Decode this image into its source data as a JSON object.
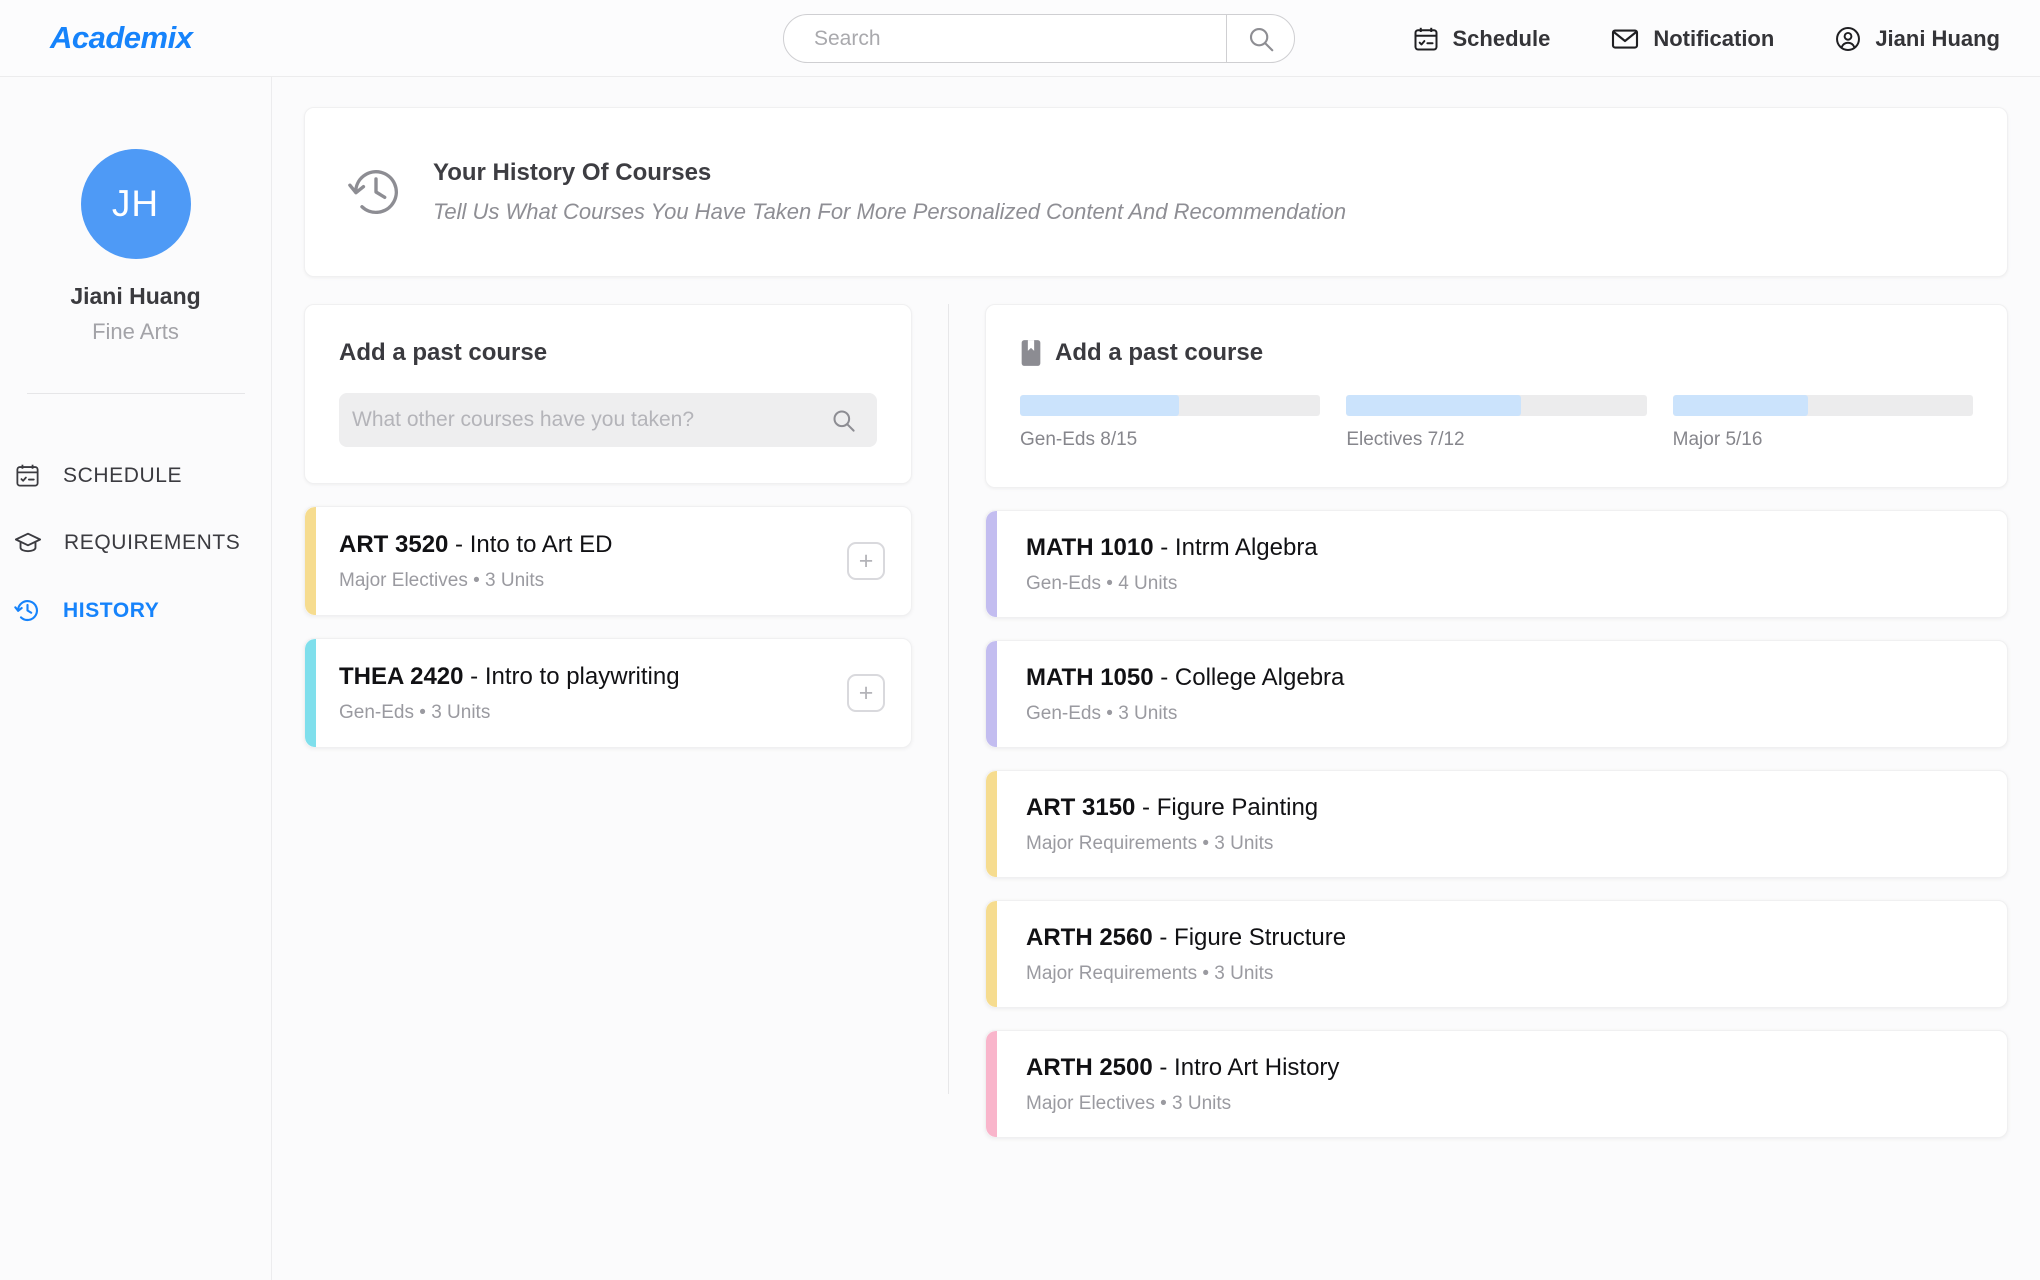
{
  "brand": {
    "name": "Academix"
  },
  "header": {
    "search": {
      "value": "",
      "placeholder": "Search"
    },
    "nav": [
      {
        "label": "Schedule",
        "icon": "calendar-check-icon"
      },
      {
        "label": "Notification",
        "icon": "envelope-icon"
      },
      {
        "label": "Jiani Huang",
        "icon": "user-circle-icon"
      }
    ]
  },
  "sidebar": {
    "avatar_initials": "JH",
    "user_name": "Jiani Huang",
    "user_major": "Fine Arts",
    "items": [
      {
        "label": "SCHEDULE",
        "icon": "calendar-check-icon",
        "active": false
      },
      {
        "label": "REQUIREMENTS",
        "icon": "graduation-cap-icon",
        "active": false
      },
      {
        "label": "HISTORY",
        "icon": "history-clock-icon",
        "active": true
      }
    ]
  },
  "banner": {
    "icon": "history-clock-icon",
    "title": "Your History Of Courses",
    "subtitle": "Tell Us What Courses You Have Taken For More Personalized Content And Recommendation"
  },
  "left_panel": {
    "title": "Add a past course",
    "search": {
      "value": "",
      "placeholder": "What other courses have you taken?"
    },
    "courses": [
      {
        "code": "ART 3520",
        "separator": " - ",
        "name": "Into to Art ED",
        "meta": "Major Electives • 3 Units",
        "accent": "#f6dc8f",
        "add_label": "+"
      },
      {
        "code": "THEA 2420",
        "separator": "  - ",
        "name": "Intro to playwriting",
        "meta": "Gen-Eds • 3 Units",
        "accent": "#7fdfec",
        "add_label": "+"
      }
    ]
  },
  "right_panel": {
    "title": "Add a past course",
    "icon": "book-icon",
    "progress": [
      {
        "label": "Gen-Eds  8/15",
        "percent": 53,
        "fill": "#cbe3fc"
      },
      {
        "label": "Electives  7/12",
        "percent": 58,
        "fill": "#cbe3fc"
      },
      {
        "label": "Major  5/16",
        "percent": 45,
        "fill": "#cbe3fc"
      }
    ],
    "courses": [
      {
        "code": "MATH 1010",
        "separator": " - ",
        "name": "Intrm Algebra",
        "meta": "Gen-Eds • 4 Units",
        "accent": "#c3bdf0"
      },
      {
        "code": "MATH 1050",
        "separator": " - ",
        "name": "College Algebra",
        "meta": "Gen-Eds • 3 Units",
        "accent": "#c3bdf0"
      },
      {
        "code": "ART 3150",
        "separator": " - ",
        "name": "Figure Painting",
        "meta": "Major Requirements • 3 Units",
        "accent": "#f6dc8f"
      },
      {
        "code": "ARTH 2560",
        "separator": " - ",
        "name": "Figure Structure",
        "meta": "Major Requirements • 3 Units",
        "accent": "#f6dc8f"
      },
      {
        "code": "ARTH 2500",
        "separator": " - ",
        "name": "Intro Art History",
        "meta": "Major Electives •  3 Units",
        "accent": "#f9b5cb"
      }
    ]
  },
  "colors": {
    "brand_blue": "#1683fb",
    "avatar_blue": "#4e9af6",
    "progress_fill": "#cbe3fc",
    "accent_yellow": "#f6dc8f",
    "accent_cyan": "#7fdfec",
    "accent_purple": "#c3bdf0",
    "accent_pink": "#f9b5cb"
  }
}
